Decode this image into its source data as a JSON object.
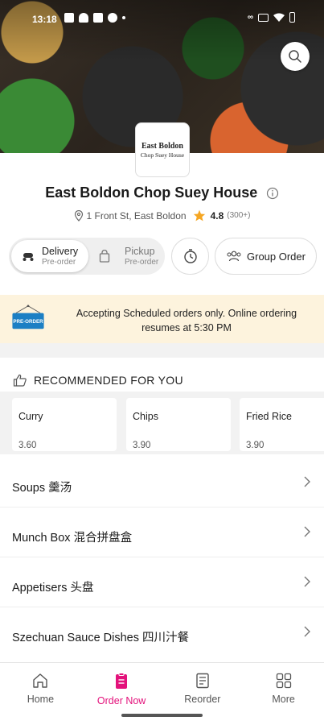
{
  "status_bar": {
    "time": "13:18"
  },
  "restaurant": {
    "logo_line1": "East Boldon",
    "logo_line2": "Chop Suey House",
    "name": "East Boldon Chop Suey House",
    "address": "1 Front St, East Boldon",
    "rating": "4.8",
    "rating_count": "(300+)"
  },
  "order_type": {
    "delivery_label": "Delivery",
    "delivery_sub": "Pre-order",
    "pickup_label": "Pickup",
    "pickup_sub": "Pre-order",
    "group_order_label": "Group Order"
  },
  "banner": {
    "sign_text": "PRE-ORDER",
    "message": "Accepting Scheduled orders only. Online ordering resumes at 5:30 PM"
  },
  "recommended": {
    "heading": "RECOMMENDED FOR YOU",
    "items": [
      {
        "name": "Curry",
        "price": "3.60"
      },
      {
        "name": "Chips",
        "price": "3.90"
      },
      {
        "name": "Fried Rice",
        "price": "3.90"
      }
    ]
  },
  "categories": [
    {
      "label": "Soups 羹汤"
    },
    {
      "label": "Munch Box 混合拼盘盒"
    },
    {
      "label": "Appetisers 头盘"
    },
    {
      "label": "Szechuan Sauce Dishes 四川汁餐"
    }
  ],
  "bottom_nav": {
    "home": "Home",
    "order_now": "Order Now",
    "reorder": "Reorder",
    "more": "More"
  },
  "colors": {
    "accent": "#e3127b",
    "banner_bg": "#fdf3dd",
    "star": "#f5a623",
    "sign_blue": "#1c7fc4"
  }
}
